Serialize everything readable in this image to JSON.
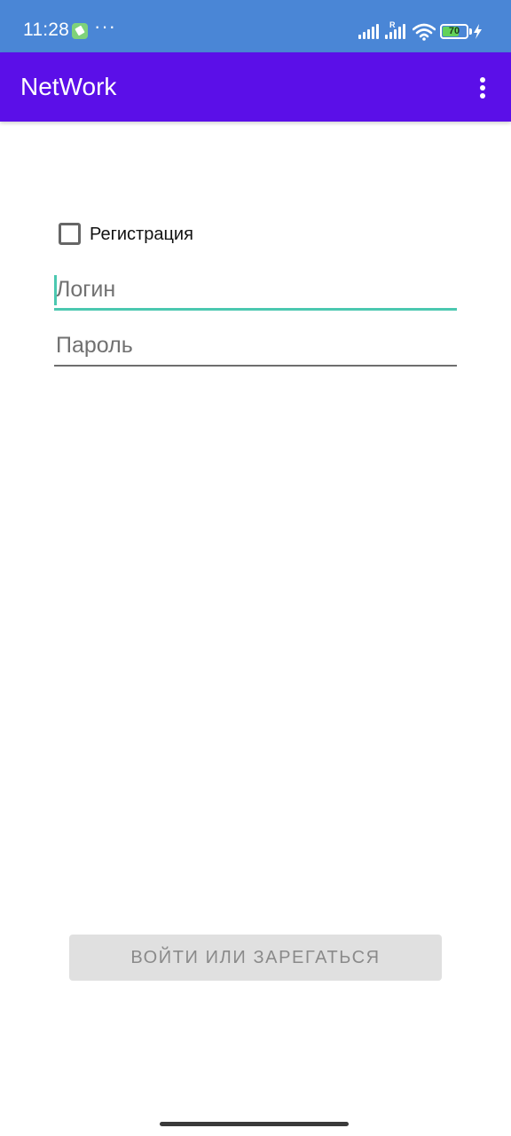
{
  "status_bar": {
    "time": "11:28",
    "more_glyph": "···",
    "battery_label": "70",
    "battery_level": 0.7,
    "app_icon": "wrench-icon",
    "roaming_letter": "R",
    "colors": {
      "background": "#4a86d6",
      "battery": "#62d25a"
    }
  },
  "app_bar": {
    "title": "NetWork",
    "overflow_icon": "more-vert-icon",
    "color": "#5b0fe8"
  },
  "form": {
    "register_label": "Регистрация",
    "register_checked": false,
    "login_placeholder": "Логин",
    "login_value": "",
    "password_placeholder": "Пароль",
    "password_value": "",
    "accent_color": "#4bc8b0",
    "submit_label": "ВОЙТИ ИЛИ ЗАРЕГАТЬСЯ",
    "submit_enabled": false
  }
}
